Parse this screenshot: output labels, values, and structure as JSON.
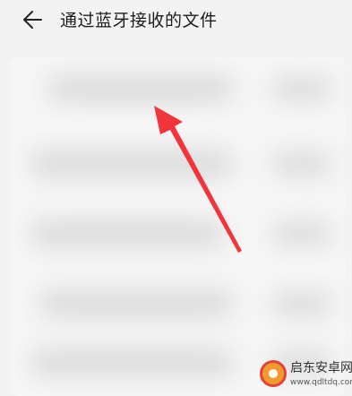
{
  "header": {
    "title": "通过蓝牙接收的文件",
    "back_icon": "arrow-left-icon"
  },
  "file_list": {
    "state": "blurred",
    "row_count": 5
  },
  "annotation": {
    "arrow_icon": "red-arrow-icon",
    "color": "#f2353a"
  },
  "watermark": {
    "name": "启东安卓网",
    "url": "www.qdltdq.com"
  }
}
